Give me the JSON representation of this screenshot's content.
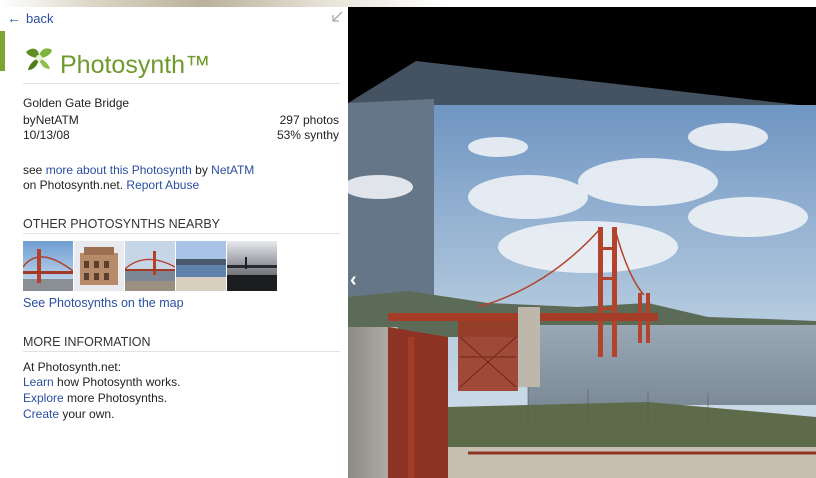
{
  "header": {
    "back_label": "back"
  },
  "synth": {
    "app_name": "Photosynth™",
    "title": "Golden Gate Bridge",
    "by_prefix": "by",
    "author": "NetATM",
    "photos_count": "297",
    "photos_label": "photos",
    "date": "10/13/08",
    "synthy": "53% synthy"
  },
  "about": {
    "see_prefix": "see",
    "more_link": "more about this Photosynth",
    "by_word": "by",
    "author_link": "NetATM",
    "on_text": "on Photosynth.net.",
    "report_link": "Report Abuse"
  },
  "nearby": {
    "heading": "OTHER PHOTOSYNTHS NEARBY",
    "map_link": "See Photosynths on the map"
  },
  "more_info": {
    "heading": "MORE INFORMATION",
    "intro": "At Photosynth.net:",
    "learn_link": "Learn",
    "learn_rest": "how Photosynth works.",
    "explore_link": "Explore",
    "explore_rest": "more Photosynths.",
    "create_link": "Create",
    "create_rest": "your own."
  },
  "colors": {
    "link": "#2a4ea0",
    "brand_green": "#6f9a2b",
    "accent": "#7aa62f"
  }
}
